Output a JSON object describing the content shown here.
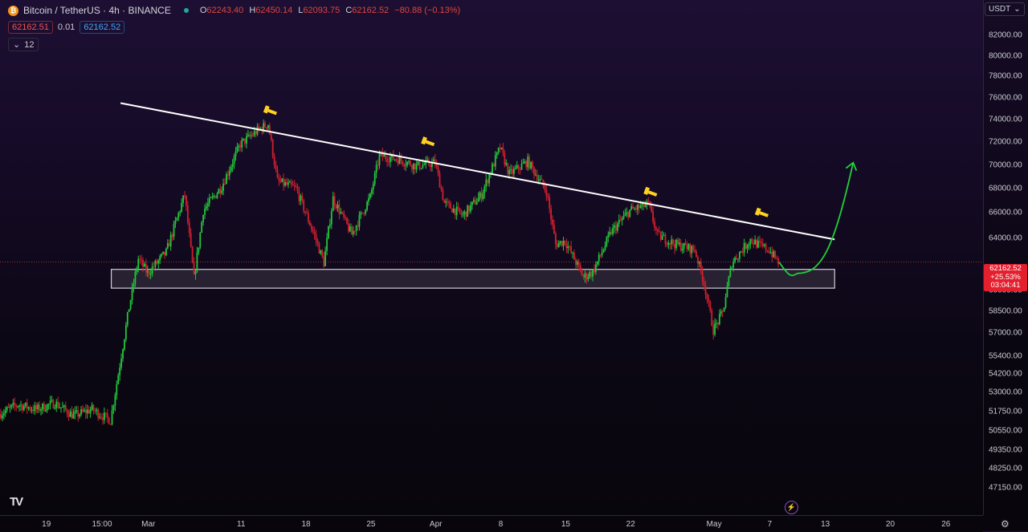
{
  "header": {
    "coin_icon": "bitcoin-icon",
    "symbol": "Bitcoin / TetherUS · 4h · BINANCE",
    "ohlc": {
      "o_label": "O",
      "o": "62243.40",
      "h_label": "H",
      "h": "62450.14",
      "l_label": "L",
      "l": "62093.75",
      "c_label": "C",
      "c": "62162.52",
      "change": "−80.88 (−0.13%)"
    },
    "sell_price": "62162.51",
    "spread": "0.01",
    "buy_price": "62162.52",
    "indicators_toggle": "12"
  },
  "currency_selector": "USDT",
  "last_price_badge": {
    "price": "62162.52",
    "change": "+25.53%",
    "countdown": "03:04:41"
  },
  "colors": {
    "up": "#22c73a",
    "down": "#d0202e",
    "trendline": "#ffffff",
    "projection": "#1fd13a",
    "zone": "#cfcfd6",
    "marker": "#ffd21f"
  },
  "price_axis": {
    "ticks": [
      {
        "value": 82000,
        "label": "82000.00"
      },
      {
        "value": 80000,
        "label": "80000.00"
      },
      {
        "value": 78000,
        "label": "78000.00"
      },
      {
        "value": 76000,
        "label": "76000.00"
      },
      {
        "value": 74000,
        "label": "74000.00"
      },
      {
        "value": 72000,
        "label": "72000.00"
      },
      {
        "value": 70000,
        "label": "70000.00"
      },
      {
        "value": 68000,
        "label": "68000.00"
      },
      {
        "value": 66000,
        "label": "66000.00"
      },
      {
        "value": 64000,
        "label": "64000.00"
      },
      {
        "value": 60000,
        "label": "60000.00"
      },
      {
        "value": 58500,
        "label": "58500.00"
      },
      {
        "value": 57000,
        "label": "57000.00"
      },
      {
        "value": 55400,
        "label": "55400.00"
      },
      {
        "value": 54200,
        "label": "54200.00"
      },
      {
        "value": 53000,
        "label": "53000.00"
      },
      {
        "value": 51750,
        "label": "51750.00"
      },
      {
        "value": 50550,
        "label": "50550.00"
      },
      {
        "value": 49350,
        "label": "49350.00"
      },
      {
        "value": 48250,
        "label": "48250.00"
      },
      {
        "value": 47150,
        "label": "47150.00"
      }
    ]
  },
  "time_axis": {
    "ticks": [
      {
        "date": "2024-02-19",
        "label": "19"
      },
      {
        "date": "2024-02-25",
        "label": "15:00"
      },
      {
        "date": "2024-03-01",
        "label": "Mar"
      },
      {
        "date": "2024-03-11",
        "label": "11"
      },
      {
        "date": "2024-03-18",
        "label": "18"
      },
      {
        "date": "2024-03-25",
        "label": "25"
      },
      {
        "date": "2024-04-01",
        "label": "Apr"
      },
      {
        "date": "2024-04-08",
        "label": "8"
      },
      {
        "date": "2024-04-15",
        "label": "15"
      },
      {
        "date": "2024-04-22",
        "label": "22"
      },
      {
        "date": "2024-05-01",
        "label": "May"
      },
      {
        "date": "2024-05-07",
        "label": "7"
      },
      {
        "date": "2024-05-13",
        "label": "13"
      },
      {
        "date": "2024-05-20",
        "label": "20"
      },
      {
        "date": "2024-05-26",
        "label": "26"
      }
    ]
  },
  "chart_data": {
    "type": "candlestick",
    "title": "",
    "interval": "4h",
    "x_type": "date",
    "xlim": [
      "2024-02-14",
      "2024-05-30"
    ],
    "y_scale": "log",
    "ylim": [
      46500,
      83500
    ],
    "grid": false,
    "legend": "none",
    "price_path": [
      {
        "x": "2024-02-14",
        "y": 51600
      },
      {
        "x": "2024-02-16",
        "y": 52200
      },
      {
        "x": "2024-02-18",
        "y": 51900
      },
      {
        "x": "2024-02-20",
        "y": 52300
      },
      {
        "x": "2024-02-22",
        "y": 51500
      },
      {
        "x": "2024-02-24",
        "y": 51900
      },
      {
        "x": "2024-02-26",
        "y": 51200
      },
      {
        "x": "2024-02-27",
        "y": 54800
      },
      {
        "x": "2024-02-28",
        "y": 58800
      },
      {
        "x": "2024-02-29",
        "y": 62400
      },
      {
        "x": "2024-03-01",
        "y": 61300
      },
      {
        "x": "2024-03-03",
        "y": 62900
      },
      {
        "x": "2024-03-05",
        "y": 67500
      },
      {
        "x": "2024-03-06",
        "y": 60900
      },
      {
        "x": "2024-03-07",
        "y": 66200
      },
      {
        "x": "2024-03-09",
        "y": 68200
      },
      {
        "x": "2024-03-11",
        "y": 71800
      },
      {
        "x": "2024-03-13",
        "y": 73100
      },
      {
        "x": "2024-03-14",
        "y": 73600
      },
      {
        "x": "2024-03-15",
        "y": 68600
      },
      {
        "x": "2024-03-17",
        "y": 68000
      },
      {
        "x": "2024-03-19",
        "y": 64200
      },
      {
        "x": "2024-03-20",
        "y": 62100
      },
      {
        "x": "2024-03-21",
        "y": 67200
      },
      {
        "x": "2024-03-23",
        "y": 64300
      },
      {
        "x": "2024-03-25",
        "y": 67300
      },
      {
        "x": "2024-03-26",
        "y": 70800
      },
      {
        "x": "2024-03-28",
        "y": 70500
      },
      {
        "x": "2024-03-30",
        "y": 69900
      },
      {
        "x": "2024-04-01",
        "y": 70200
      },
      {
        "x": "2024-04-02",
        "y": 66800
      },
      {
        "x": "2024-04-04",
        "y": 65800
      },
      {
        "x": "2024-04-06",
        "y": 67500
      },
      {
        "x": "2024-04-08",
        "y": 71500
      },
      {
        "x": "2024-04-09",
        "y": 69200
      },
      {
        "x": "2024-04-11",
        "y": 70300
      },
      {
        "x": "2024-04-13",
        "y": 67800
      },
      {
        "x": "2024-04-14",
        "y": 63500
      },
      {
        "x": "2024-04-15",
        "y": 63800
      },
      {
        "x": "2024-04-17",
        "y": 61000
      },
      {
        "x": "2024-04-18",
        "y": 61400
      },
      {
        "x": "2024-04-20",
        "y": 64500
      },
      {
        "x": "2024-04-22",
        "y": 66200
      },
      {
        "x": "2024-04-24",
        "y": 66700
      },
      {
        "x": "2024-04-25",
        "y": 64200
      },
      {
        "x": "2024-04-27",
        "y": 63500
      },
      {
        "x": "2024-04-29",
        "y": 63100
      },
      {
        "x": "2024-04-30",
        "y": 60600
      },
      {
        "x": "2024-05-01",
        "y": 57200
      },
      {
        "x": "2024-05-02",
        "y": 58400
      },
      {
        "x": "2024-05-03",
        "y": 62100
      },
      {
        "x": "2024-05-05",
        "y": 63900
      },
      {
        "x": "2024-05-06",
        "y": 63400
      },
      {
        "x": "2024-05-07",
        "y": 63100
      },
      {
        "x": "2024-05-08",
        "y": 62160
      }
    ],
    "annotations": {
      "descending_trendline": [
        {
          "x": "2024-02-27",
          "y": 75500
        },
        {
          "x": "2024-05-14",
          "y": 63900
        }
      ],
      "support_zone": {
        "x_start": "2024-02-26",
        "x_end": "2024-05-14",
        "y_low": 60200,
        "y_high": 61600
      },
      "projected_path": [
        {
          "x": "2024-05-08",
          "y": 62160
        },
        {
          "x": "2024-05-10",
          "y": 61300
        },
        {
          "x": "2024-05-13",
          "y": 62500
        },
        {
          "x": "2024-05-16",
          "y": 70200
        }
      ],
      "touch_markers": [
        {
          "x": "2024-03-14",
          "y": 74800
        },
        {
          "x": "2024-03-31",
          "y": 72000
        },
        {
          "x": "2024-04-24",
          "y": 67700
        },
        {
          "x": "2024-05-06",
          "y": 66000
        }
      ]
    }
  }
}
